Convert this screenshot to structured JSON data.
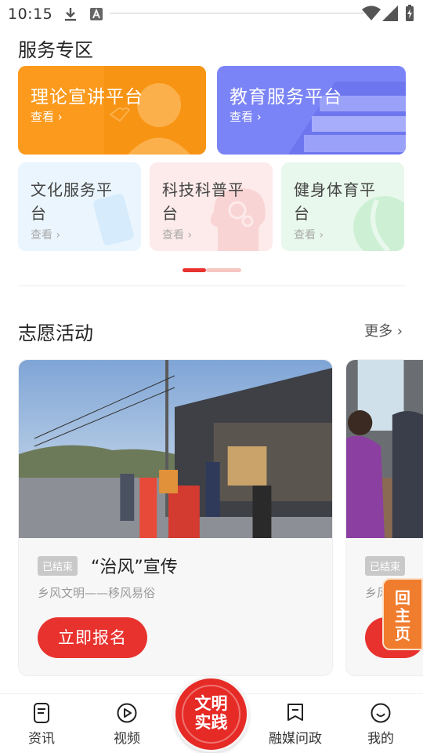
{
  "status_bar": {
    "time": "10:15"
  },
  "service_section": {
    "title": "服务专区",
    "cards": [
      {
        "title": "理论宣讲平台",
        "view": "查看 ›",
        "color": "#fb9a1c"
      },
      {
        "title": "教育服务平台",
        "view": "查看 ›",
        "color": "#7b84f6"
      },
      {
        "title": "文化服务平台",
        "view": "查看 ›",
        "color": "#eaf5fd"
      },
      {
        "title": "科技科普平台",
        "view": "查看 ›",
        "color": "#fdeaea"
      },
      {
        "title": "健身体育平台",
        "view": "查看 ›",
        "color": "#e8f8ec"
      }
    ]
  },
  "volunteer_section": {
    "title": "志愿活动",
    "more": "更多 ›",
    "activities": [
      {
        "status": "已结束",
        "title": "“治风”宣传",
        "subtitle": "乡风文明——移风易俗",
        "button": "立即报名"
      },
      {
        "status": "已结束",
        "title": "",
        "subtitle": "乡风",
        "button": ""
      }
    ]
  },
  "float_home": {
    "label": "回主页"
  },
  "tabbar": {
    "tabs": [
      {
        "label": "资讯",
        "icon": "document-icon"
      },
      {
        "label": "视频",
        "icon": "play-icon"
      },
      {
        "label": "融媒问政",
        "icon": "bookmark-icon"
      },
      {
        "label": "我的",
        "icon": "smile-icon"
      }
    ],
    "center": {
      "line1": "文明",
      "line2": "实践"
    }
  },
  "colors": {
    "accent": "#e8322e",
    "orange": "#f07c2e"
  }
}
